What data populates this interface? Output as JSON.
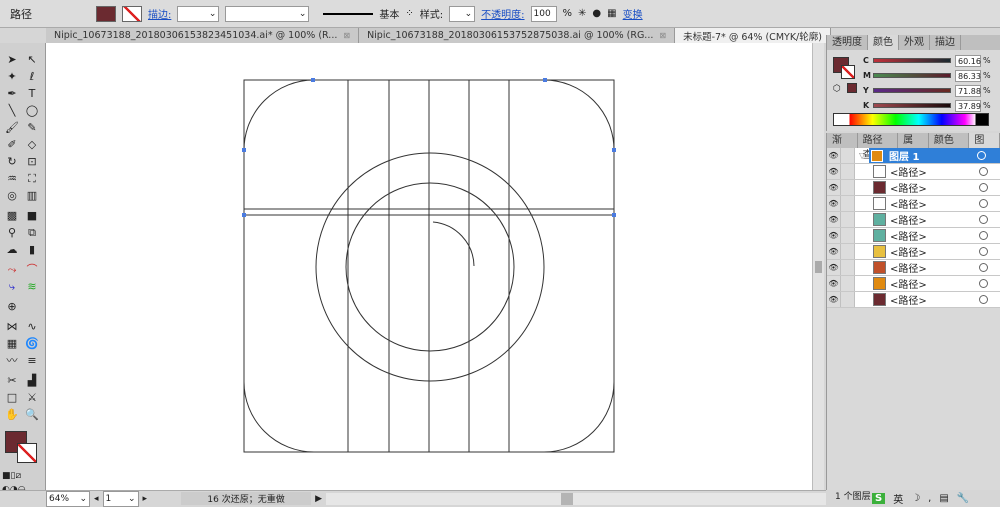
{
  "control_bar": {
    "selection_type": "路径",
    "fill_color": "#6b2a30",
    "stroke_label": "描边:",
    "stroke_profile": "基本",
    "style_label": "样式:",
    "opacity_label": "不透明度:",
    "opacity_value": "100",
    "opacity_unit": "%",
    "transform_label": "变换"
  },
  "doc_tabs": [
    {
      "label": "Nipic_10673188_20180306153823451034.ai* @ 100% (R...",
      "active": false
    },
    {
      "label": "Nipic_10673188_20180306153752875038.ai @ 100% (RG...",
      "active": false
    },
    {
      "label": "未标题-7* @ 64% (CMYK/轮廓)",
      "active": true
    }
  ],
  "color_panel": {
    "tabs": [
      "透明度",
      "颜色",
      "外观",
      "描边"
    ],
    "active_tab": "颜色",
    "channels": [
      {
        "label": "C",
        "value": "60.16",
        "unit": "%"
      },
      {
        "label": "M",
        "value": "86.33",
        "unit": "%"
      },
      {
        "label": "Y",
        "value": "71.88",
        "unit": "%"
      },
      {
        "label": "K",
        "value": "37.89",
        "unit": "%"
      }
    ]
  },
  "layers_panel": {
    "tabs": [
      "渐变",
      "路径查",
      "属性",
      "颜色参",
      "图层"
    ],
    "active_tab": "图层",
    "layer_name": "图层 1",
    "items": [
      {
        "label": "<路径>",
        "thumb": "#ffffff"
      },
      {
        "label": "<路径>",
        "thumb": "#6b2a30"
      },
      {
        "label": "<路径>",
        "thumb": "#ffffff"
      },
      {
        "label": "<路径>",
        "thumb": "#5fb0a0"
      },
      {
        "label": "<路径>",
        "thumb": "#5fb0a0"
      },
      {
        "label": "<路径>",
        "thumb": "#e8c040"
      },
      {
        "label": "<路径>",
        "thumb": "#c0502a"
      },
      {
        "label": "<路径>",
        "thumb": "#e08a10"
      },
      {
        "label": "<路径>",
        "thumb": "#6b2a30"
      }
    ],
    "footer": "1 个图层"
  },
  "status_bar": {
    "zoom": "64%",
    "artboard": "1",
    "history": "16 次还原；无重做"
  },
  "taskbar": {
    "ime": "英"
  }
}
